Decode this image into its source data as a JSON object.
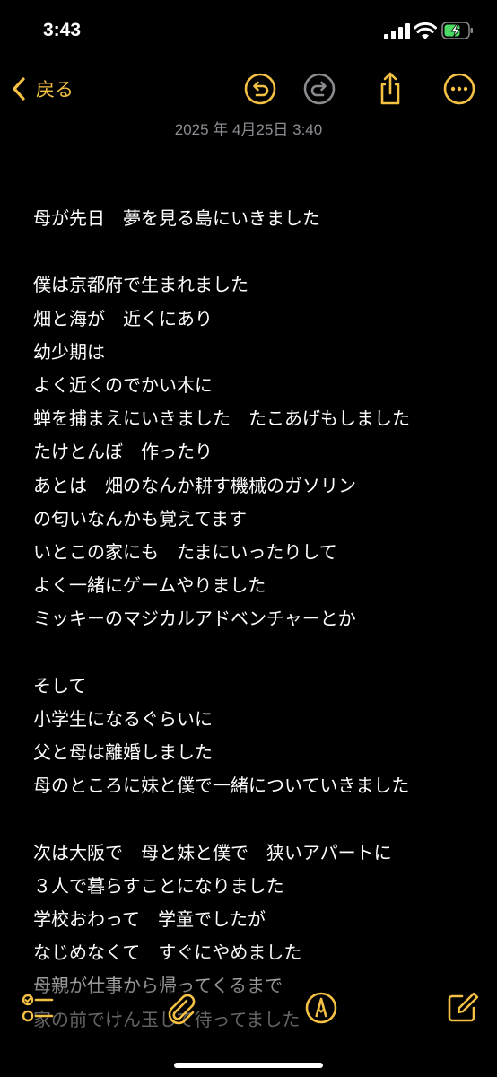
{
  "status_bar": {
    "time": "3:43",
    "icons": [
      "signal-icon",
      "wifi-icon",
      "battery-charging-icon"
    ]
  },
  "toolbar": {
    "back_label": "戻る",
    "buttons": [
      "undo-icon",
      "redo-icon",
      "share-icon",
      "more-icon"
    ]
  },
  "note": {
    "date": "2025 年 4月25日 3:40",
    "lines": [
      "母が先日　夢を見る島にいきました",
      "",
      "僕は京都府で生まれました",
      "畑と海が　近くにあり",
      "幼少期は",
      "よく近くのでかい木に",
      "蝉を捕まえにいきました　たこあげもしました",
      "たけとんぼ　作ったり",
      "あとは　畑のなんか耕す機械のガソリン",
      "の匂いなんかも覚えてます",
      "いとこの家にも　たまにいったりして",
      "よく一緒にゲームやりました",
      "ミッキーのマジカルアドベンチャーとか",
      "",
      "そして",
      "小学生になるぐらいに",
      "父と母は離婚しました",
      "母のところに妹と僕で一緒についていきました",
      "",
      "次は大阪で　母と妹と僕で　狭いアパートに",
      "３人で暮らすことになりました",
      "学校おわって　学童でしたが",
      "なじめなくて　すぐにやめました",
      "母親が仕事から帰ってくるまで",
      "家の前でけん玉して待ってました"
    ]
  },
  "bottom_toolbar": {
    "buttons": [
      "checklist-icon",
      "paperclip-icon",
      "markup-pen-icon",
      "compose-icon"
    ]
  },
  "colors": {
    "accent": "#f4c145",
    "background": "#000000",
    "text": "#ffffff",
    "date": "#8d8d93"
  }
}
